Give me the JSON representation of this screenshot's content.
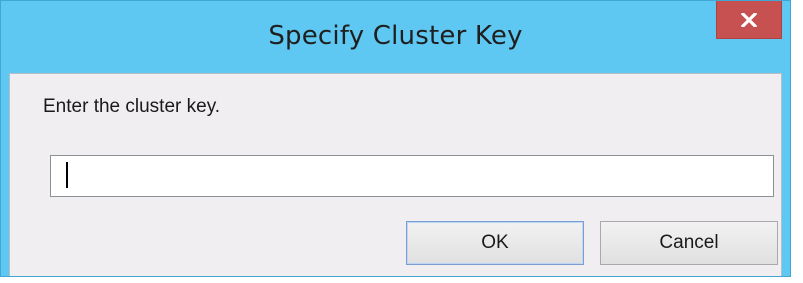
{
  "window": {
    "title": "Specify Cluster Key",
    "close_icon": "close-icon",
    "close_glyph": "x"
  },
  "dialog": {
    "prompt": "Enter the cluster key.",
    "cluster_key_value": "",
    "cluster_key_placeholder": ""
  },
  "buttons": {
    "ok_label": "OK",
    "cancel_label": "Cancel"
  },
  "colors": {
    "frame": "#5ec7f2",
    "close_button": "#c75050",
    "client_area": "#f1eef2"
  }
}
